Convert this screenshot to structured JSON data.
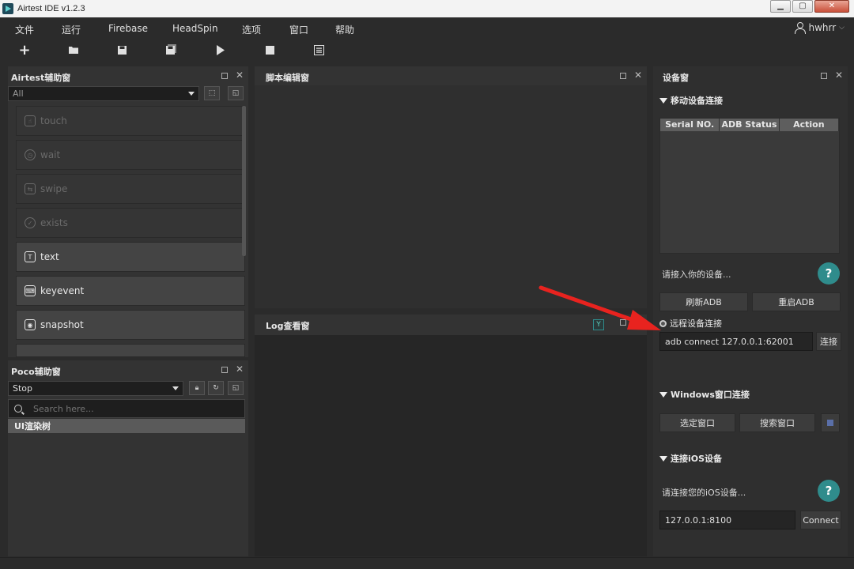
{
  "window": {
    "title": "Airtest IDE v1.2.3"
  },
  "menu": [
    "文件",
    "运行",
    "Firebase",
    "HeadSpin",
    "选项",
    "窗口",
    "帮助"
  ],
  "user": {
    "name": "hwhrr"
  },
  "toolbar": [
    "new-file",
    "open-folder",
    "save",
    "save-all",
    "run",
    "stop",
    "log"
  ],
  "airtest_panel": {
    "title": "Airtest辅助窗",
    "filter_value": "All",
    "apis": [
      {
        "label": "touch",
        "enabled": false
      },
      {
        "label": "wait",
        "enabled": false
      },
      {
        "label": "swipe",
        "enabled": false
      },
      {
        "label": "exists",
        "enabled": false
      },
      {
        "label": "text",
        "enabled": true
      },
      {
        "label": "keyevent",
        "enabled": true
      },
      {
        "label": "snapshot",
        "enabled": true
      }
    ]
  },
  "poco_panel": {
    "title": "Poco辅助窗",
    "mode_value": "Stop",
    "search_placeholder": "Search here...",
    "tree_root": "UI渲染树"
  },
  "script_panel": {
    "title": "脚本编辑窗"
  },
  "log_panel": {
    "title": "Log查看窗"
  },
  "device_panel": {
    "title": "设备窗",
    "mobile_section": "移动设备连接",
    "table_headers": [
      "Serial NO.",
      "ADB Status",
      "Action"
    ],
    "connect_hint": "请接入你的设备...",
    "refresh_adb": "刷新ADB",
    "restart_adb": "重启ADB",
    "remote_label": "远程设备连接",
    "remote_value": "adb connect 127.0.0.1:62001",
    "remote_connect": "连接",
    "windows_section": "Windows窗口连接",
    "select_window": "选定窗口",
    "search_window": "搜索窗口",
    "ios_section": "连接iOS设备",
    "ios_hint": "请连接您的iOS设备...",
    "ios_value": "127.0.0.1:8100",
    "ios_connect": "Connect",
    "help": "?"
  },
  "colors": {
    "annotation_arrow": "#e8231f",
    "help_button": "#2f8c8c"
  }
}
